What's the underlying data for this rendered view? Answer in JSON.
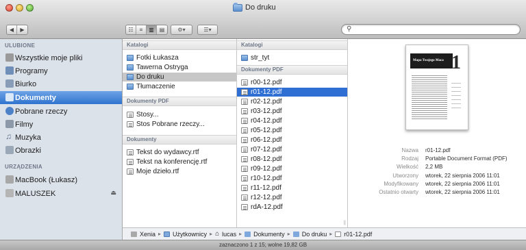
{
  "window": {
    "title": "Do druku"
  },
  "search": {
    "placeholder": ""
  },
  "sidebar": {
    "favorites_heading": "ULUBIONE",
    "favorites": [
      {
        "label": "Wszystkie moje pliki",
        "icon": "all-files-icon",
        "color": "#9a9a9a"
      },
      {
        "label": "Programy",
        "icon": "applications-icon",
        "color": "#6f8fb8"
      },
      {
        "label": "Biurko",
        "icon": "desktop-icon",
        "color": "#8a9db8"
      },
      {
        "label": "Dokumenty",
        "icon": "documents-icon",
        "color": "#5f90d6"
      },
      {
        "label": "Pobrane rzeczy",
        "icon": "downloads-icon",
        "color": "#4d82c8"
      },
      {
        "label": "Filmy",
        "icon": "movies-icon",
        "color": "#8d99a8"
      },
      {
        "label": "Muzyka",
        "icon": "music-icon",
        "color": "#8da0b8"
      },
      {
        "label": "Obrazki",
        "icon": "pictures-icon",
        "color": "#9aa8b8"
      }
    ],
    "devices_heading": "URZĄDZENIA",
    "devices": [
      {
        "label": "MacBook (Łukasz)",
        "icon": "laptop-icon",
        "color": "#a8a8a8"
      },
      {
        "label": "MALUSZEK",
        "icon": "drive-icon",
        "color": "#b5b5b5"
      }
    ],
    "selected": "Dokumenty"
  },
  "column1": {
    "folders_heading": "Katalogi",
    "folders": [
      "Fotki Łukasza",
      "Tawerna Ostryga",
      "Do druku",
      "Tłumaczenie"
    ],
    "pdf_heading": "Dokumenty PDF",
    "pdfs": [
      "Stosy...",
      "Stos Pobrane rzeczy..."
    ],
    "docs_heading": "Dokumenty",
    "docs": [
      "Tekst do wydawcy.rtf",
      "Tekst na konferencję.rtf",
      "Moje dzieło.rtf"
    ]
  },
  "column2": {
    "folders_heading": "Katalogi",
    "folders": [
      "str_tyt"
    ],
    "pdf_heading": "Dokumenty PDF",
    "pdfs": [
      "r00-12.pdf",
      "r01-12.pdf",
      "r02-12.pdf",
      "r03-12.pdf",
      "r04-12.pdf",
      "r05-12.pdf",
      "r06-12.pdf",
      "r07-12.pdf",
      "r08-12.pdf",
      "r09-12.pdf",
      "r10-12.pdf",
      "r11-12.pdf",
      "r12-12.pdf",
      "rdA-12.pdf"
    ],
    "selected": "r01-12.pdf"
  },
  "preview": {
    "thumb_title": "Mapa Twojego Maca",
    "thumb_number": "1",
    "info": [
      {
        "label": "Nazwa",
        "value": "r01-12.pdf"
      },
      {
        "label": "Rodzaj",
        "value": "Portable Document Format (PDF)"
      },
      {
        "label": "Wielkość",
        "value": "2,2 MB"
      },
      {
        "label": "Utworzony",
        "value": "wtorek, 22 sierpnia 2006 11:01"
      },
      {
        "label": "Modyfikowany",
        "value": "wtorek, 22 sierpnia 2006 11:01"
      },
      {
        "label": "Ostatnio otwarty",
        "value": "wtorek, 22 sierpnia 2006 11:01"
      }
    ]
  },
  "pathbar": {
    "items": [
      {
        "label": "Xenia",
        "icon": "drive-icon"
      },
      {
        "label": "Użytkownicy",
        "icon": "folder-icon"
      },
      {
        "label": "lucas",
        "icon": "home-icon"
      },
      {
        "label": "Dokumenty",
        "icon": "folder-icon"
      },
      {
        "label": "Do druku",
        "icon": "folder-icon"
      },
      {
        "label": "r01-12.pdf",
        "icon": "pdf-icon"
      }
    ],
    "separator": "▸"
  },
  "statusbar": {
    "text": "zaznaczono 1 z 15; wolne 19,82 GB"
  },
  "toolbar": {
    "back": "◀",
    "forward": "▶",
    "view_icons": "☷",
    "view_list": "≡",
    "view_columns": "▥",
    "view_coverflow": "▤",
    "action": "⚙▾",
    "arrange": "☰▾"
  },
  "colors": {
    "selection": "#2f6ed3",
    "sidebar": "#dce2ea",
    "sidebar_selected": "#3f7fd6"
  }
}
